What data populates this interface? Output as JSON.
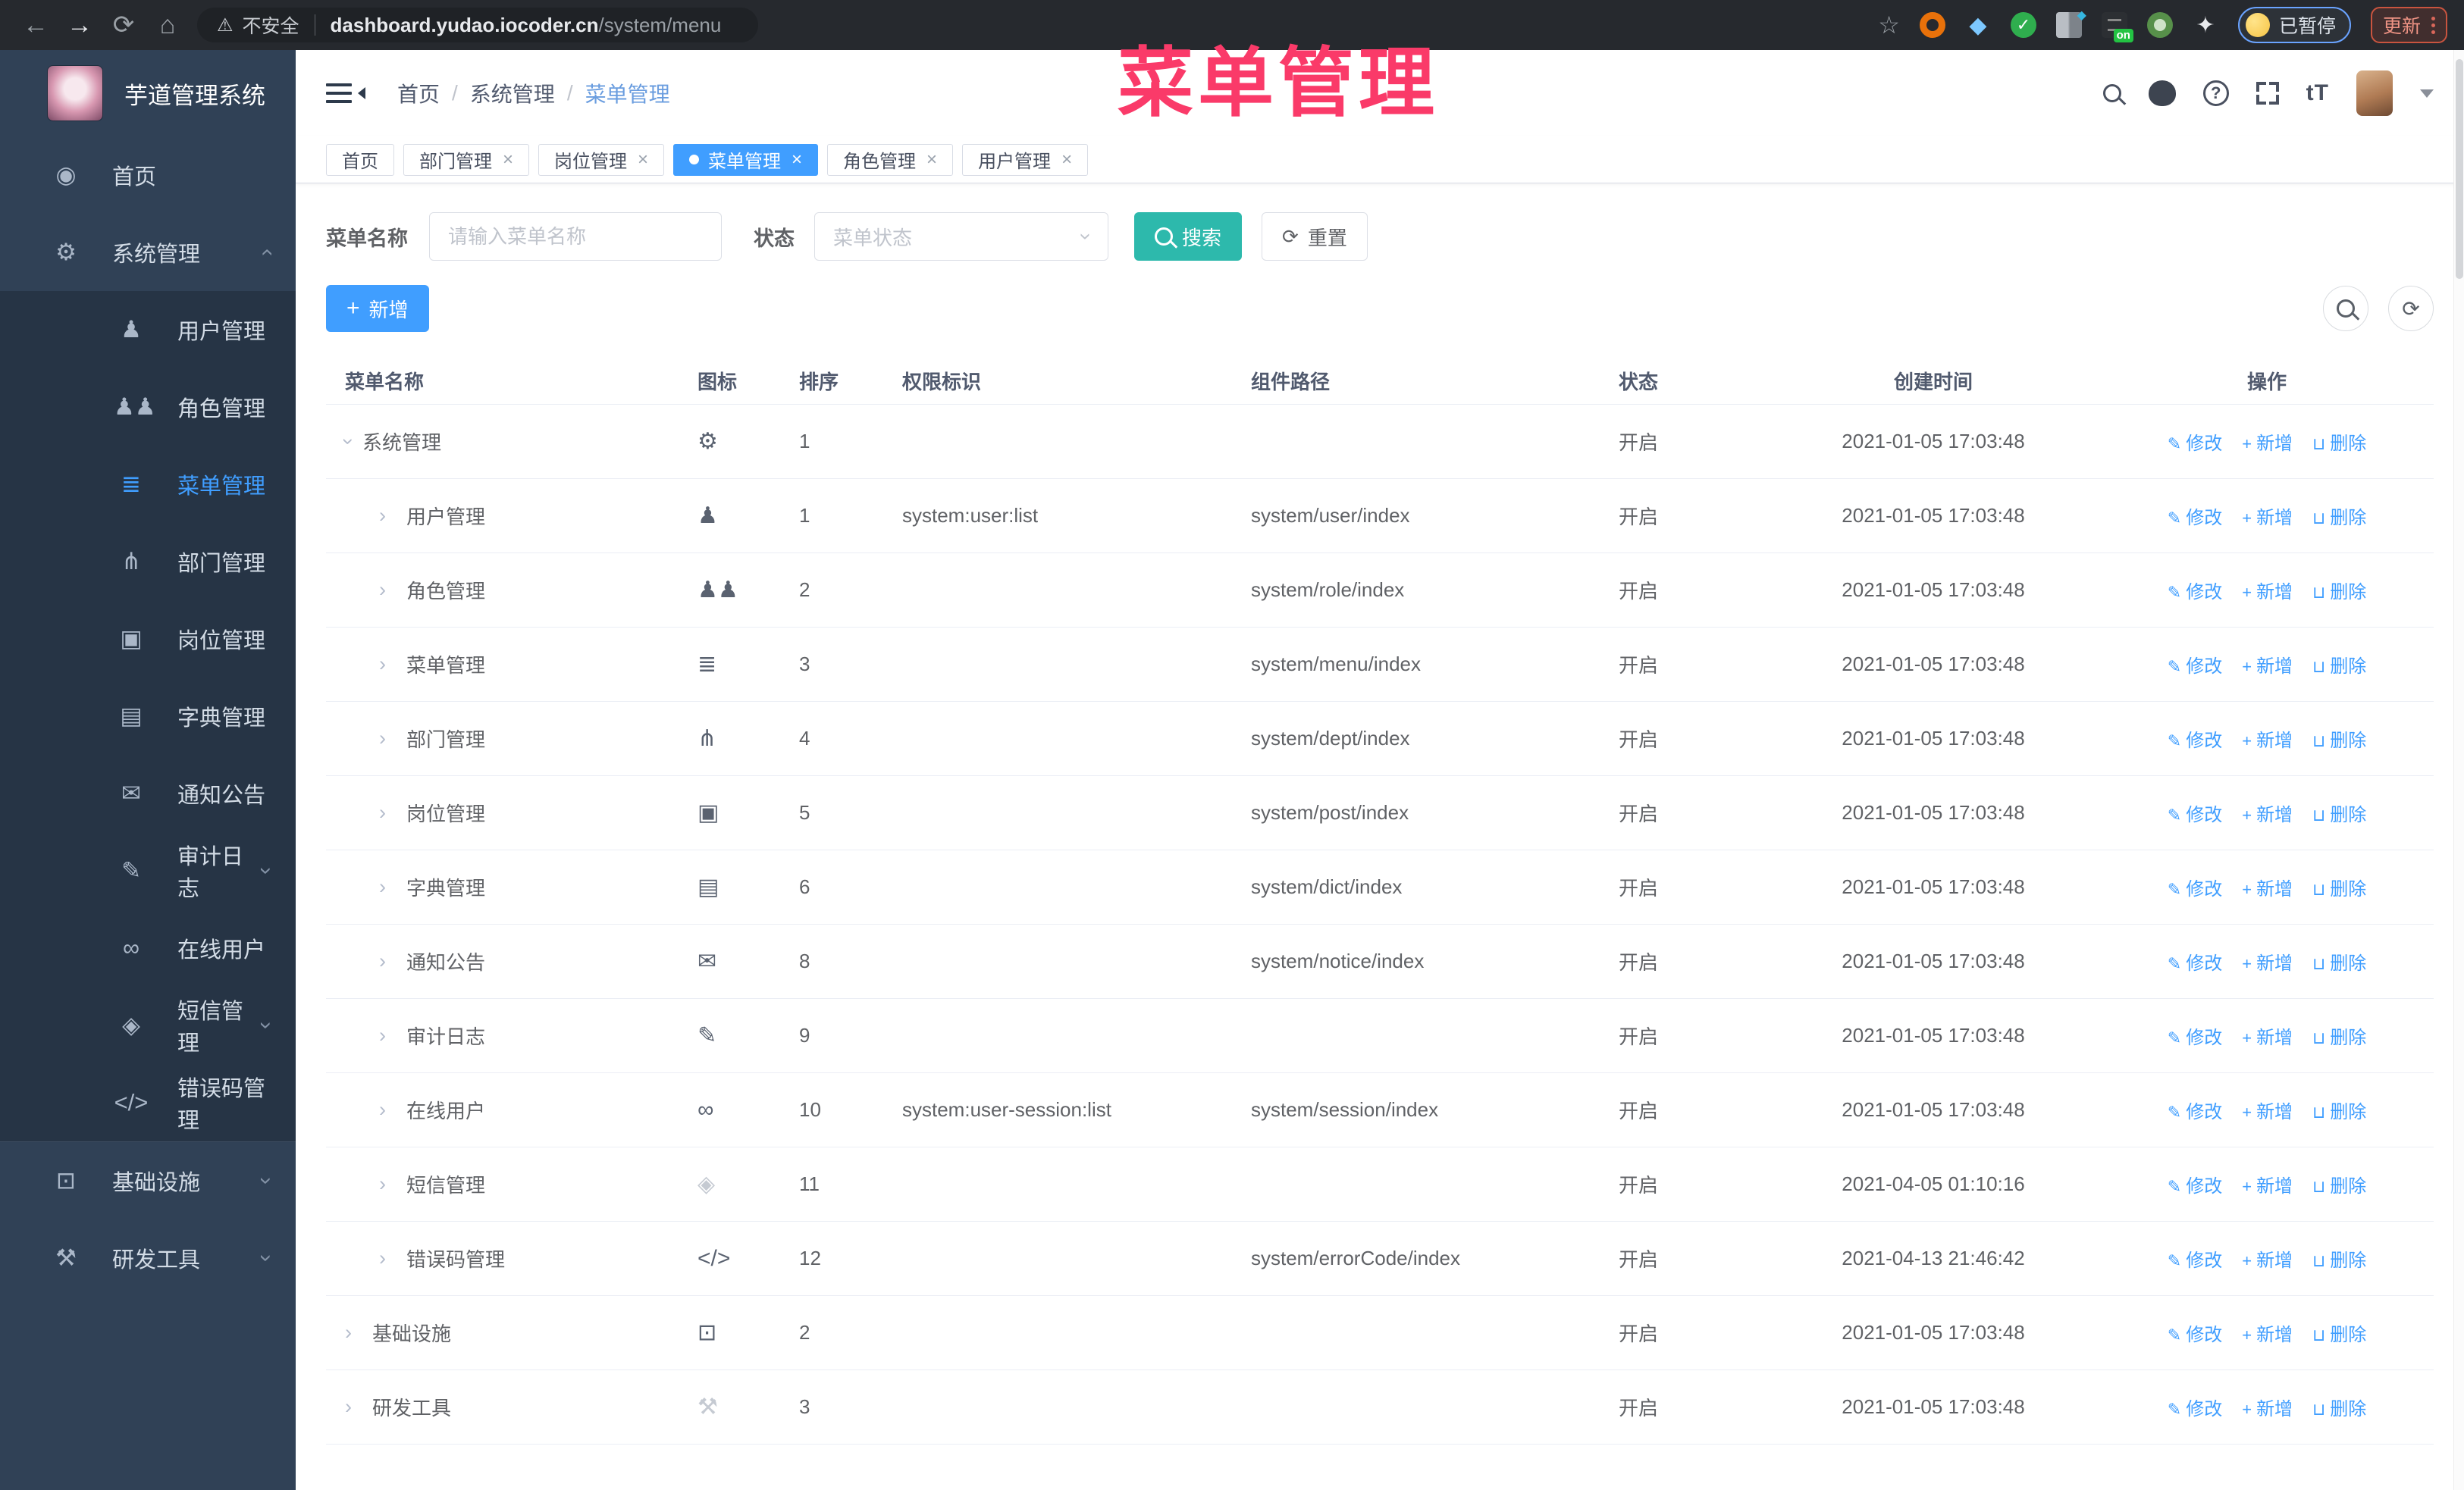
{
  "browser": {
    "nav_icons": [
      "back-icon",
      "forward-icon",
      "reload-icon",
      "home-icon"
    ],
    "security_label": "不安全",
    "url_host": "dashboard.yudao.iocoder.cn",
    "url_path": "/system/menu",
    "extension_icons": [
      "star-icon",
      "orange-extension-icon",
      "gem-extension-icon",
      "green-check-extension-icon",
      "split-extension-icon",
      "on-badge-extension-icon",
      "monkey-extension-icon",
      "puzzle-icon"
    ],
    "on_badge_label": "on",
    "paused_label": "已暂停",
    "update_label": "更新"
  },
  "watermark": {
    "text": "菜单管理"
  },
  "sidebar": {
    "logo_title": "芋道管理系统",
    "top1": [
      {
        "key": "home",
        "label": "首页",
        "icon": "dashboard-icon",
        "chevron": null
      },
      {
        "key": "system",
        "label": "系统管理",
        "icon": "gear-icon",
        "chevron": "up"
      }
    ],
    "sub": [
      {
        "key": "user",
        "label": "用户管理",
        "icon": "user-icon",
        "chevron": null
      },
      {
        "key": "role",
        "label": "角色管理",
        "icon": "users-icon",
        "chevron": null
      },
      {
        "key": "menu",
        "label": "菜单管理",
        "icon": "menu-list-icon",
        "chevron": null,
        "active": true
      },
      {
        "key": "dept",
        "label": "部门管理",
        "icon": "tree-icon",
        "chevron": null
      },
      {
        "key": "post",
        "label": "岗位管理",
        "icon": "badge-icon",
        "chevron": null
      },
      {
        "key": "dict",
        "label": "字典管理",
        "icon": "book-icon",
        "chevron": null
      },
      {
        "key": "notice",
        "label": "通知公告",
        "icon": "megaphone-icon",
        "chevron": null
      },
      {
        "key": "audit",
        "label": "审计日志",
        "icon": "edit-icon",
        "chevron": "down"
      },
      {
        "key": "online",
        "label": "在线用户",
        "icon": "link-icon",
        "chevron": null
      },
      {
        "key": "sms",
        "label": "短信管理",
        "icon": "shield-icon",
        "chevron": "down"
      },
      {
        "key": "errorcode",
        "label": "错误码管理",
        "icon": "code-icon",
        "chevron": null
      }
    ],
    "top2": [
      {
        "key": "infra",
        "label": "基础设施",
        "icon": "monitor-icon",
        "chevron": "down"
      },
      {
        "key": "tools",
        "label": "研发工具",
        "icon": "toolbox-icon",
        "chevron": "down"
      }
    ]
  },
  "header": {
    "breadcrumb": [
      "首页",
      "系统管理",
      "菜单管理"
    ],
    "icons": [
      "search-icon",
      "github-icon",
      "help-icon",
      "fullscreen-icon",
      "font-size-icon",
      "user-avatar",
      "chevron-down-icon"
    ]
  },
  "tabs": [
    {
      "key": "home",
      "label": "首页",
      "active": false,
      "closable": false
    },
    {
      "key": "dept",
      "label": "部门管理",
      "active": false,
      "closable": true
    },
    {
      "key": "post",
      "label": "岗位管理",
      "active": false,
      "closable": true
    },
    {
      "key": "menu",
      "label": "菜单管理",
      "active": true,
      "closable": true
    },
    {
      "key": "role",
      "label": "角色管理",
      "active": false,
      "closable": true
    },
    {
      "key": "user",
      "label": "用户管理",
      "active": false,
      "closable": true
    }
  ],
  "search_form": {
    "name_label": "菜单名称",
    "name_placeholder": "请输入菜单名称",
    "status_label": "状态",
    "status_placeholder": "菜单状态",
    "search_label": "搜索",
    "reset_label": "重置"
  },
  "toolbar": {
    "add_label": "新增"
  },
  "table": {
    "columns": [
      "菜单名称",
      "图标",
      "排序",
      "权限标识",
      "组件路径",
      "状态",
      "创建时间",
      "操作"
    ],
    "action_labels": {
      "edit": "修改",
      "add": "新增",
      "delete": "删除"
    },
    "rows": [
      {
        "key": "system",
        "level": 1,
        "expanded": true,
        "name": "系统管理",
        "icon": "gear-icon",
        "icon_light": false,
        "sort": "1",
        "perm": "",
        "path": "",
        "status": "开启",
        "created": "2021-01-05 17:03:48"
      },
      {
        "key": "user",
        "level": 2,
        "expanded": false,
        "name": "用户管理",
        "icon": "user-icon",
        "icon_light": false,
        "sort": "1",
        "perm": "system:user:list",
        "path": "system/user/index",
        "status": "开启",
        "created": "2021-01-05 17:03:48"
      },
      {
        "key": "role",
        "level": 2,
        "expanded": false,
        "name": "角色管理",
        "icon": "users-icon",
        "icon_light": false,
        "sort": "2",
        "perm": "",
        "path": "system/role/index",
        "status": "开启",
        "created": "2021-01-05 17:03:48"
      },
      {
        "key": "menu",
        "level": 2,
        "expanded": false,
        "name": "菜单管理",
        "icon": "menu-list-icon",
        "icon_light": false,
        "sort": "3",
        "perm": "",
        "path": "system/menu/index",
        "status": "开启",
        "created": "2021-01-05 17:03:48"
      },
      {
        "key": "dept",
        "level": 2,
        "expanded": false,
        "name": "部门管理",
        "icon": "tree-icon",
        "icon_light": false,
        "sort": "4",
        "perm": "",
        "path": "system/dept/index",
        "status": "开启",
        "created": "2021-01-05 17:03:48"
      },
      {
        "key": "post",
        "level": 2,
        "expanded": false,
        "name": "岗位管理",
        "icon": "badge-icon",
        "icon_light": false,
        "sort": "5",
        "perm": "",
        "path": "system/post/index",
        "status": "开启",
        "created": "2021-01-05 17:03:48"
      },
      {
        "key": "dict",
        "level": 2,
        "expanded": false,
        "name": "字典管理",
        "icon": "book-icon",
        "icon_light": false,
        "sort": "6",
        "perm": "",
        "path": "system/dict/index",
        "status": "开启",
        "created": "2021-01-05 17:03:48"
      },
      {
        "key": "notice",
        "level": 2,
        "expanded": false,
        "name": "通知公告",
        "icon": "megaphone-icon",
        "icon_light": false,
        "sort": "8",
        "perm": "",
        "path": "system/notice/index",
        "status": "开启",
        "created": "2021-01-05 17:03:48"
      },
      {
        "key": "audit",
        "level": 2,
        "expanded": false,
        "name": "审计日志",
        "icon": "edit-icon",
        "icon_light": false,
        "sort": "9",
        "perm": "",
        "path": "",
        "status": "开启",
        "created": "2021-01-05 17:03:48"
      },
      {
        "key": "online",
        "level": 2,
        "expanded": false,
        "name": "在线用户",
        "icon": "link-icon",
        "icon_light": false,
        "sort": "10",
        "perm": "system:user-session:list",
        "path": "system/session/index",
        "status": "开启",
        "created": "2021-01-05 17:03:48"
      },
      {
        "key": "sms",
        "level": 2,
        "expanded": false,
        "name": "短信管理",
        "icon": "shield-icon",
        "icon_light": true,
        "sort": "11",
        "perm": "",
        "path": "",
        "status": "开启",
        "created": "2021-04-05 01:10:16"
      },
      {
        "key": "errorcode",
        "level": 2,
        "expanded": false,
        "name": "错误码管理",
        "icon": "code-icon",
        "icon_light": false,
        "sort": "12",
        "perm": "",
        "path": "system/errorCode/index",
        "status": "开启",
        "created": "2021-04-13 21:46:42"
      },
      {
        "key": "infra",
        "level": 1,
        "expanded": false,
        "name": "基础设施",
        "icon": "monitor-icon",
        "icon_light": false,
        "sort": "2",
        "perm": "",
        "path": "",
        "status": "开启",
        "created": "2021-01-05 17:03:48"
      },
      {
        "key": "tools",
        "level": 1,
        "expanded": false,
        "name": "研发工具",
        "icon": "toolbox-icon",
        "icon_light": true,
        "sort": "3",
        "perm": "",
        "path": "",
        "status": "开启",
        "created": "2021-01-05 17:03:48"
      }
    ]
  },
  "icon_glyphs": {
    "back-icon": "←",
    "forward-icon": "→",
    "reload-icon": "⟳",
    "home-icon": "⌂",
    "warning-icon": "⚠",
    "star-icon": "☆",
    "gem-extension-icon": "◆",
    "check-icon": "✓",
    "font-size-icon": "tT",
    "chevron-icon": "›",
    "dashboard-icon": "◉",
    "gear-icon": "⚙",
    "user-icon": "♟",
    "users-icon": "♟♟",
    "menu-list-icon": "≣",
    "tree-icon": "⋔",
    "badge-icon": "▣",
    "book-icon": "▤",
    "megaphone-icon": "✉",
    "edit-icon": "✎",
    "link-icon": "∞",
    "shield-icon": "◈",
    "code-icon": "</>",
    "monitor-icon": "⊡",
    "toolbox-icon": "⚒",
    "edit-action-icon": "✎",
    "plus-icon": "+",
    "trash-icon": "⊔",
    "refresh-icon": "⟳"
  },
  "colors": {
    "primary": "#409eff",
    "search_button": "#2db9ac",
    "watermark": "#fa3a69",
    "sidebar_bg": "#304156",
    "sidebar_sub_bg": "#263445",
    "status_text": "#606266"
  }
}
